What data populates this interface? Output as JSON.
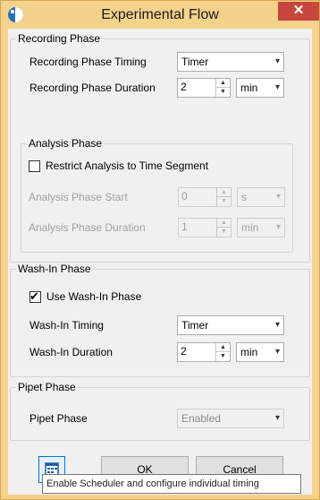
{
  "window": {
    "title": "Experimental Flow",
    "close_glyph": "✕"
  },
  "recording": {
    "title": "Recording Phase",
    "timing_label": "Recording Phase Timing",
    "timing_value": "Timer",
    "duration_label": "Recording Phase Duration",
    "duration_value": "2",
    "duration_unit": "min"
  },
  "analysis": {
    "title": "Analysis Phase",
    "restrict_label": "Restrict Analysis to Time Segment",
    "restrict_checked": false,
    "start_label": "Analysis Phase Start",
    "start_value": "0",
    "start_unit": "s",
    "duration_label": "Analysis Phase Duration",
    "duration_value": "1",
    "duration_unit": "min"
  },
  "washin": {
    "title": "Wash-In Phase",
    "use_label": "Use Wash-In Phase",
    "use_checked": true,
    "timing_label": "Wash-In Timing",
    "timing_value": "Timer",
    "duration_label": "Wash-In Duration",
    "duration_value": "2",
    "duration_unit": "min"
  },
  "pipet": {
    "title": "Pipet Phase",
    "phase_label": "Pipet Phase",
    "phase_value": "Enabled"
  },
  "buttons": {
    "ok": "OK",
    "cancel": "Cancel"
  },
  "tooltip": "Enable Scheduler and configure individual timing",
  "glyphs": {
    "dropdown": "▾",
    "spin_up": "▲",
    "spin_down": "▼",
    "check": "✔"
  },
  "colors": {
    "titlebar": "#f4d28c",
    "close": "#c7473f",
    "focus": "#0078d7"
  }
}
